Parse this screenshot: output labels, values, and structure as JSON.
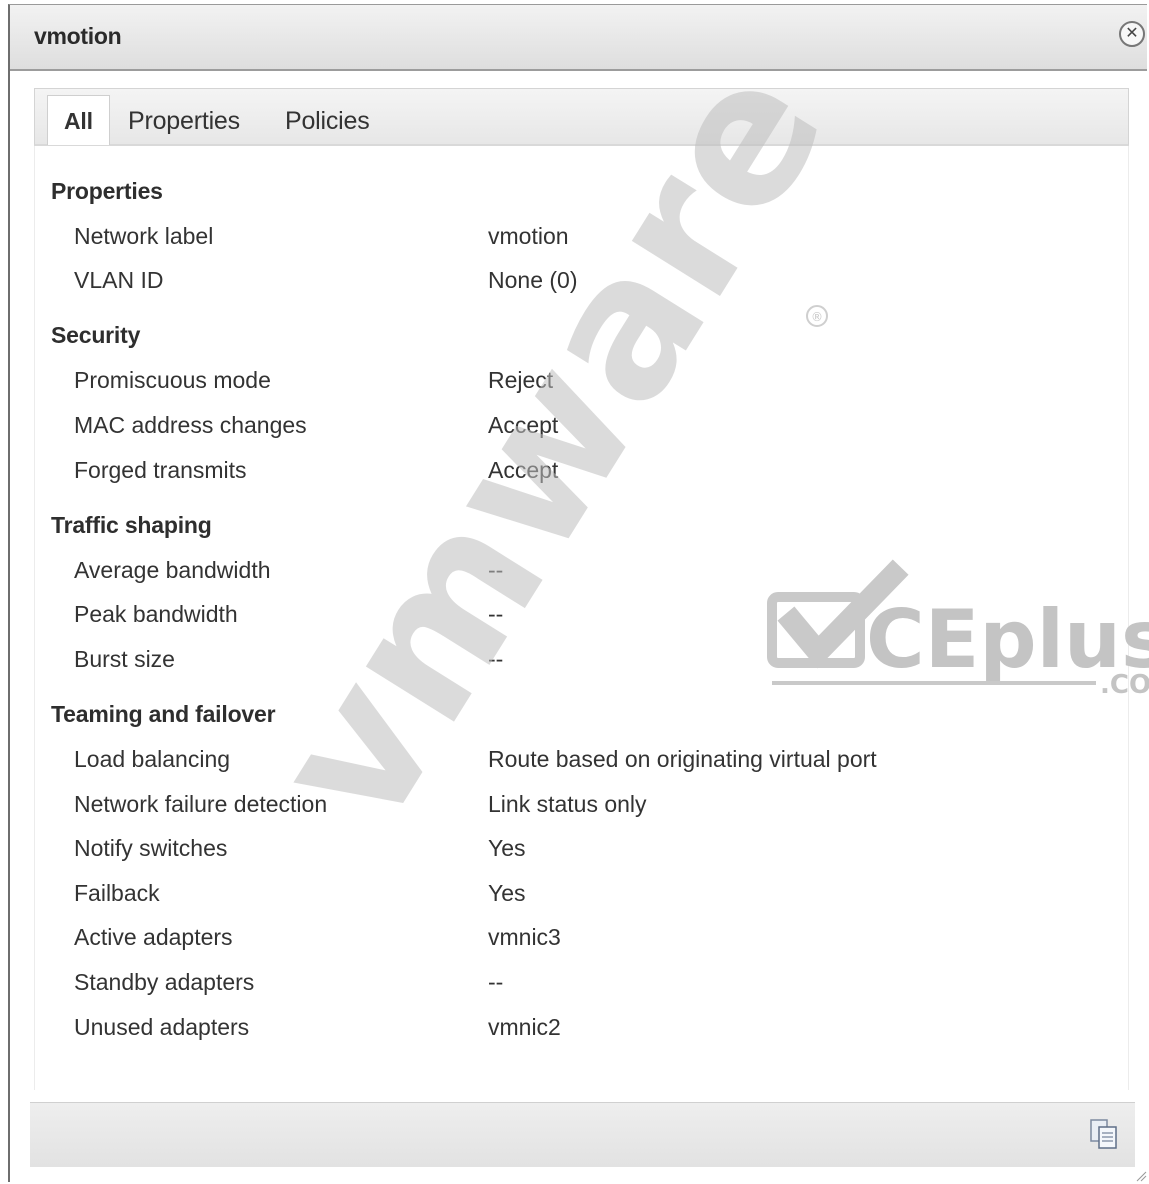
{
  "dialog": {
    "title": "vmotion",
    "close_icon": "close-icon",
    "copy_icon": "copy-icon"
  },
  "tabs": [
    {
      "label": "All",
      "active": true
    },
    {
      "label": "Properties",
      "active": false
    },
    {
      "label": "Policies",
      "active": false
    }
  ],
  "sections": [
    {
      "title": "Properties",
      "rows": [
        {
          "label": "Network label",
          "value": "vmotion"
        },
        {
          "label": "VLAN ID",
          "value": "None (0)"
        }
      ]
    },
    {
      "title": "Security",
      "rows": [
        {
          "label": "Promiscuous mode",
          "value": "Reject"
        },
        {
          "label": "MAC address changes",
          "value": "Accept"
        },
        {
          "label": "Forged transmits",
          "value": "Accept"
        }
      ]
    },
    {
      "title": "Traffic shaping",
      "rows": [
        {
          "label": "Average bandwidth",
          "value": "--"
        },
        {
          "label": "Peak bandwidth",
          "value": "--"
        },
        {
          "label": "Burst size",
          "value": "--"
        }
      ]
    },
    {
      "title": "Teaming and failover",
      "rows": [
        {
          "label": "Load balancing",
          "value": "Route based on originating virtual port"
        },
        {
          "label": "Network failure detection",
          "value": "Link status only"
        },
        {
          "label": "Notify switches",
          "value": "Yes"
        },
        {
          "label": "Failback",
          "value": "Yes"
        },
        {
          "label": "Active adapters",
          "value": "vmnic3"
        },
        {
          "label": "Standby adapters",
          "value": "--"
        },
        {
          "label": "Unused adapters",
          "value": "vmnic2"
        }
      ]
    }
  ],
  "watermarks": {
    "vmware": "vmware",
    "registered_mark": "®",
    "vceplus": "CEplus",
    "vceplus_suffix": ".CO"
  }
}
